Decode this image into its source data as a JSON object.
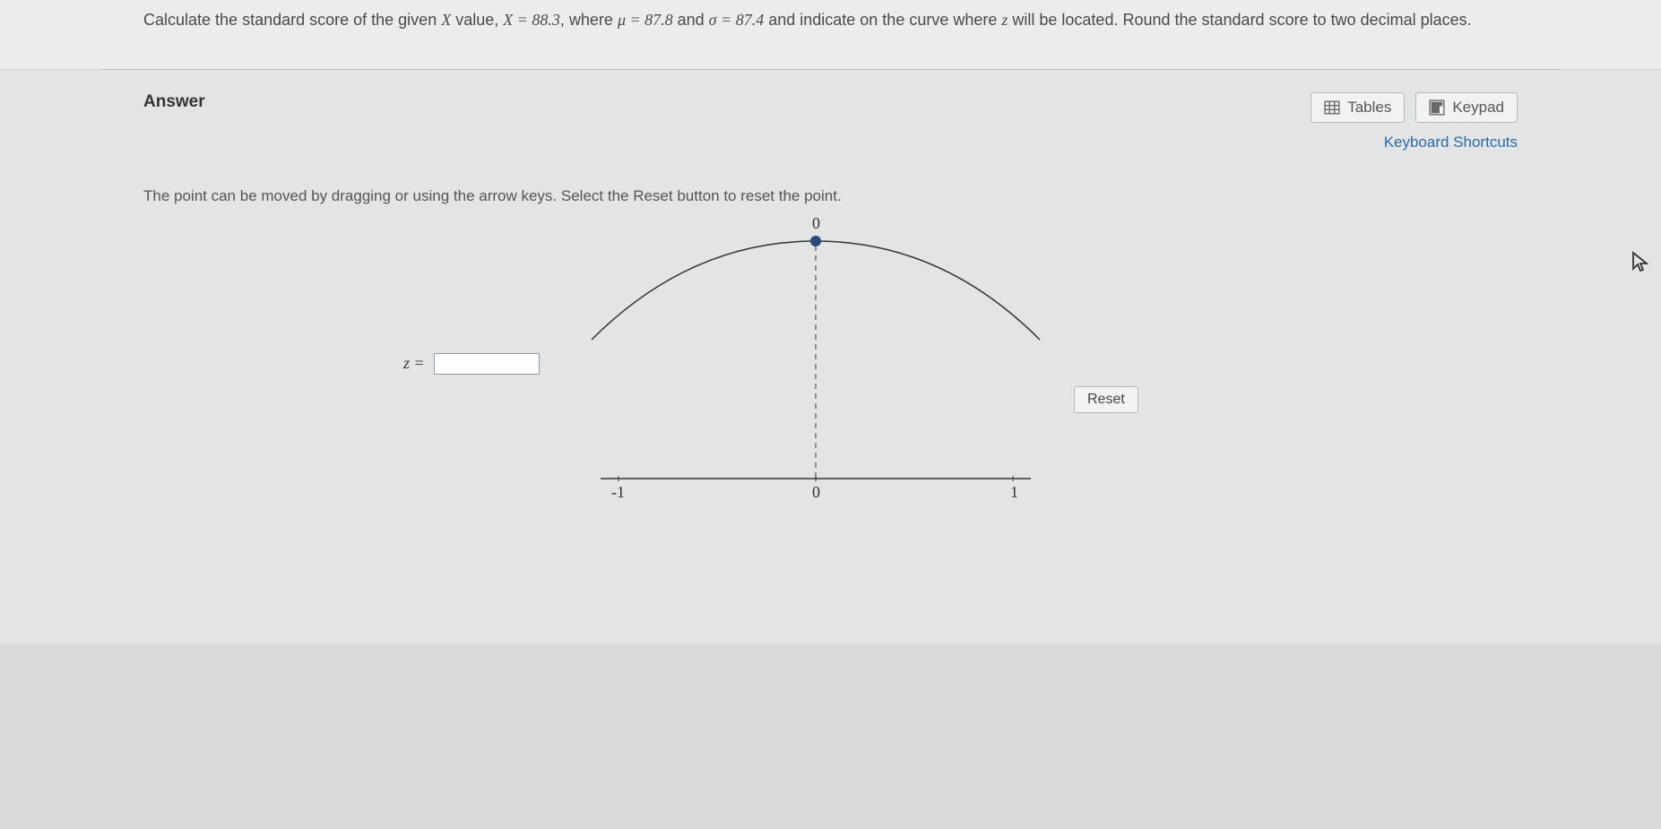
{
  "question": {
    "prefix": "Calculate the standard score of the given ",
    "xvar": "X",
    "value_text": " value, ",
    "x_eq": "X = 88.3",
    "where": ", where ",
    "mu_eq": "μ = 87.8",
    "and1": " and ",
    "sigma_eq": "σ = 87.4",
    "suffix": " and indicate on the curve where ",
    "zvar": "z",
    "located": " will be located. Round the standard score to two decimal places."
  },
  "answer": {
    "title": "Answer",
    "tables_btn": "Tables",
    "keypad_btn": "Keypad",
    "kb_shortcuts": "Keyboard Shortcuts",
    "instruction": "The point can be moved by dragging or using the arrow keys. Select the Reset button to reset the point.",
    "z_label": "z =",
    "z_value": "",
    "reset_btn": "Reset",
    "point_label": "0"
  },
  "chart_data": {
    "type": "line",
    "title": "Normal distribution curve",
    "x_ticks": [
      "-1",
      "0",
      "1"
    ],
    "point_value": 0,
    "xlim": [
      -1.2,
      1.2
    ]
  }
}
